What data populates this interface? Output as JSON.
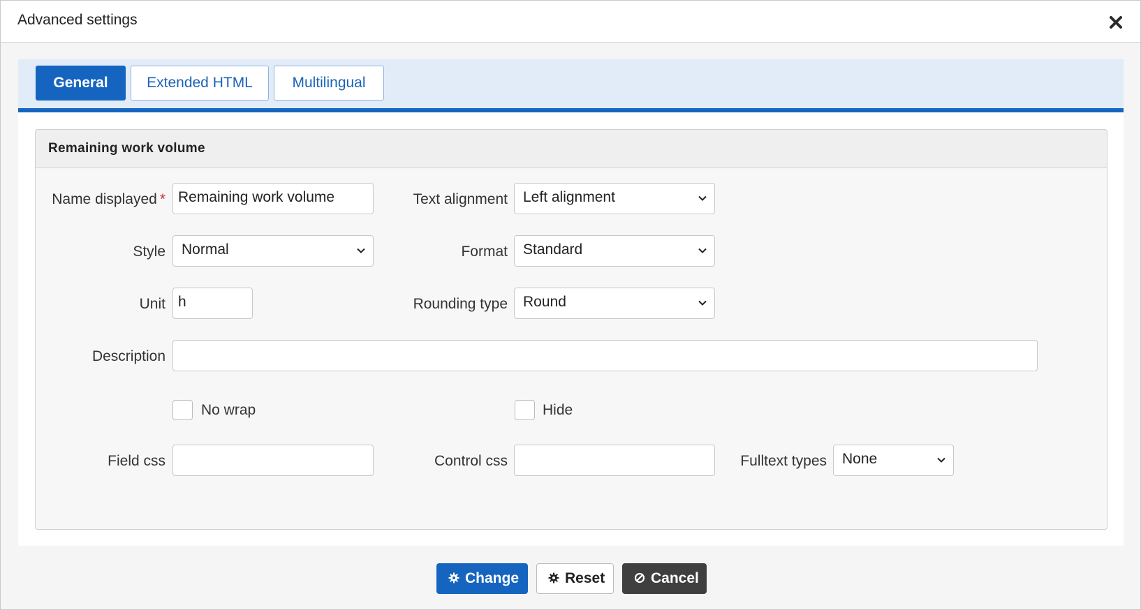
{
  "dialog": {
    "title": "Advanced settings",
    "close_icon": "close-icon"
  },
  "tabs": [
    {
      "label": "General",
      "active": true
    },
    {
      "label": "Extended HTML",
      "active": false
    },
    {
      "label": "Multilingual",
      "active": false
    }
  ],
  "section": {
    "title": "Remaining work volume"
  },
  "form": {
    "name_displayed": {
      "label": "Name displayed",
      "required_mark": "*",
      "value": "Remaining work volume"
    },
    "text_alignment": {
      "label": "Text alignment",
      "value": "Left alignment"
    },
    "style": {
      "label": "Style",
      "value": "Normal"
    },
    "format": {
      "label": "Format",
      "value": "Standard"
    },
    "unit": {
      "label": "Unit",
      "value": "h"
    },
    "rounding_type": {
      "label": "Rounding type",
      "value": "Round"
    },
    "description": {
      "label": "Description",
      "value": ""
    },
    "no_wrap": {
      "label": "No wrap",
      "checked": false
    },
    "hide": {
      "label": "Hide",
      "checked": false
    },
    "field_css": {
      "label": "Field css",
      "value": ""
    },
    "control_css": {
      "label": "Control css",
      "value": ""
    },
    "fulltext_types": {
      "label": "Fulltext types",
      "value": "None"
    }
  },
  "buttons": {
    "change": "Change",
    "reset": "Reset",
    "cancel": "Cancel"
  },
  "colors": {
    "accent": "#1565c0",
    "tabbar_bg": "#e1ecf8",
    "required": "#d32f2f",
    "cancel_bg": "#3f3f3f"
  }
}
